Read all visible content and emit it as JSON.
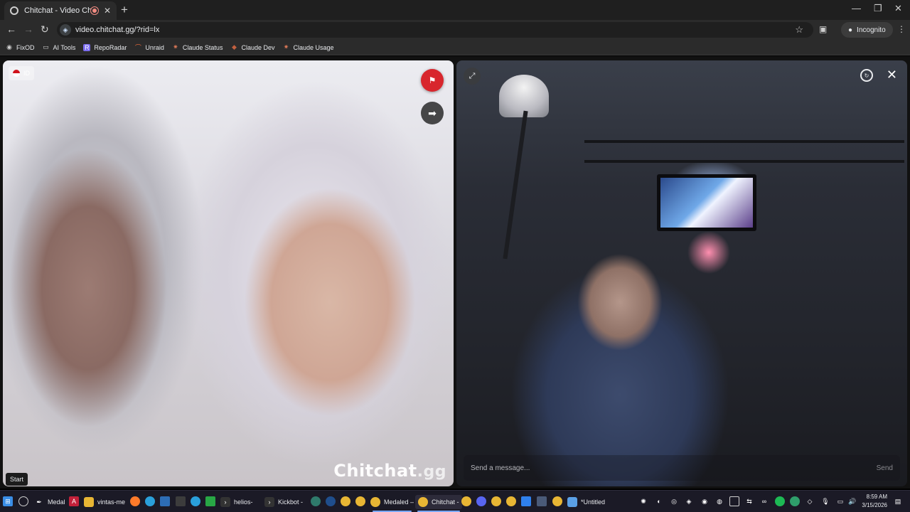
{
  "browser": {
    "tab_title": "Chitchat - Video Chat",
    "url": "video.chitchat.gg/?rid=lx",
    "incognito_label": "Incognito",
    "bookmarks": [
      {
        "label": "FixOD",
        "icon": "fixod-icon"
      },
      {
        "label": "AI Tools",
        "icon": "folder-icon"
      },
      {
        "label": "RepoRadar",
        "icon": "reporadar-icon"
      },
      {
        "label": "Unraid",
        "icon": "unraid-icon"
      },
      {
        "label": "Claude Status",
        "icon": "claude-icon"
      },
      {
        "label": "Claude Dev",
        "icon": "claude-dev-icon"
      },
      {
        "label": "Claude Usage",
        "icon": "claude-icon"
      }
    ]
  },
  "chat": {
    "stranger_country": "ID",
    "brand_main": "Chitchat",
    "brand_tld": ".gg",
    "start_tooltip": "Start",
    "message_placeholder": "Send a message...",
    "send_label": "Send"
  },
  "taskbar": {
    "items": [
      {
        "label": "Medal",
        "icon": "medal-icon"
      },
      {
        "label": "vintas-me",
        "icon": "folder-icon"
      },
      {
        "label": "helios-",
        "icon": "terminal-icon"
      },
      {
        "label": "Kickbot -",
        "icon": "terminal-icon"
      },
      {
        "label": "Medaled –",
        "icon": "chrome-icon"
      },
      {
        "label": "Chitchat -",
        "icon": "chrome-icon"
      },
      {
        "label": "*Untitled",
        "icon": "notepad-icon"
      }
    ],
    "time": "8:59 AM",
    "date": "3/15/2026"
  },
  "colors": {
    "report": "#d8262d",
    "taskbar": "#1b1a26",
    "chrome_bg": "#2b2b2b"
  }
}
